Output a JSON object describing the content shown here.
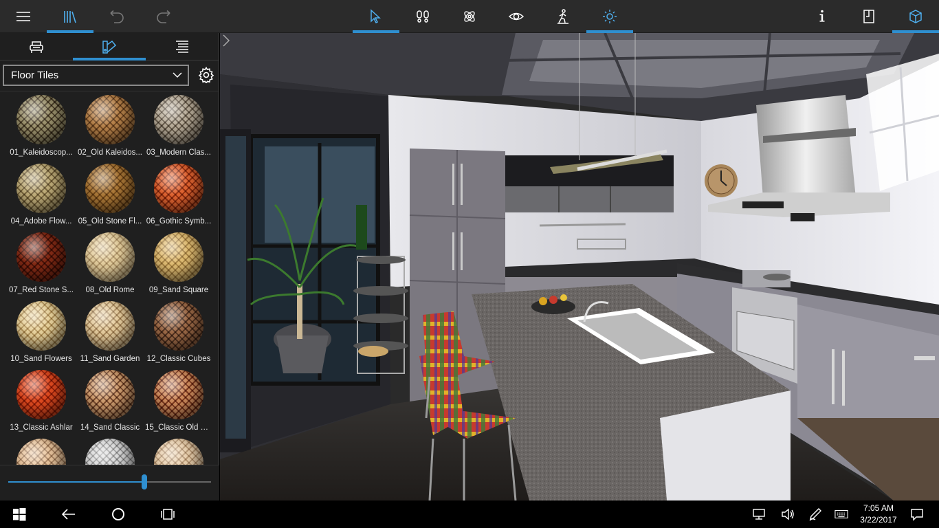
{
  "toolbar": {
    "menu": "menu-icon",
    "library": "library-icon",
    "undo": "undo-icon",
    "redo": "redo-icon",
    "select": "cursor-icon",
    "walk": "footprints-icon",
    "materials": "atom-icon",
    "view": "eye-icon",
    "person": "walking-person-icon",
    "light": "sun-icon",
    "info": "info-icon",
    "door": "door-icon",
    "view3d": "cube-icon",
    "accent_color": "#2f8fd0"
  },
  "panel": {
    "tabs": [
      "furniture-tab",
      "materials-tab",
      "list-tab"
    ],
    "category": "Floor Tiles",
    "slider_value": 0.67
  },
  "materials": [
    {
      "label": "01_Kaleidoscop...",
      "color1": "#c8c2a8",
      "color2": "#6a5d48"
    },
    {
      "label": "02_Old Kaleidos...",
      "color1": "#d9b78a",
      "color2": "#8a6a45"
    },
    {
      "label": "03_Modern Clas...",
      "color1": "#d9d2c6",
      "color2": "#7f7466"
    },
    {
      "label": "04_Adobe Flow...",
      "color1": "#ddd2b0",
      "color2": "#8f805d"
    },
    {
      "label": "05_Old Stone Fl...",
      "color1": "#d2b077",
      "color2": "#8e6c39"
    },
    {
      "label": "06_Gothic Symb...",
      "color1": "#f0a070",
      "color2": "#a14f26"
    },
    {
      "label": "07_Red Stone S...",
      "color1": "#b8694a",
      "color2": "#6a2f1c"
    },
    {
      "label": "08_Old Rome",
      "color1": "#f2e6c9",
      "color2": "#c4b190"
    },
    {
      "label": "09_Sand Square",
      "color1": "#f0dcac",
      "color2": "#b89e6a"
    },
    {
      "label": "10_Sand Flowers",
      "color1": "#f4e8c8",
      "color2": "#c0a87a"
    },
    {
      "label": "11_Sand Garden",
      "color1": "#f2e4c8",
      "color2": "#b8a07c"
    },
    {
      "label": "12_Classic Cubes",
      "color1": "#c9a587",
      "color2": "#6d5240"
    },
    {
      "label": "13_Classic Ashlar",
      "color1": "#f08a5a",
      "color2": "#a8431e"
    },
    {
      "label": "14_Sand Classic",
      "color1": "#e6c8a8",
      "color2": "#8a6248"
    },
    {
      "label": "15_Classic Old C...",
      "color1": "#e6bd9a",
      "color2": "#8d4f34"
    },
    {
      "label": "",
      "color1": "#f4e0c8",
      "color2": "#b89d83"
    },
    {
      "label": "",
      "color1": "#ececec",
      "color2": "#a6a6a6"
    },
    {
      "label": "",
      "color1": "#f4e6d2",
      "color2": "#c4ad92"
    }
  ],
  "taskbar": {
    "start": "windows-icon",
    "back": "back-arrow-icon",
    "search": "circle-icon",
    "taskview": "task-view-icon",
    "network": "network-icon",
    "volume": "volume-icon",
    "pen": "pen-icon",
    "keyboard": "keyboard-icon",
    "time": "7:05 AM",
    "date": "3/22/2017",
    "notifications": "notification-icon"
  }
}
